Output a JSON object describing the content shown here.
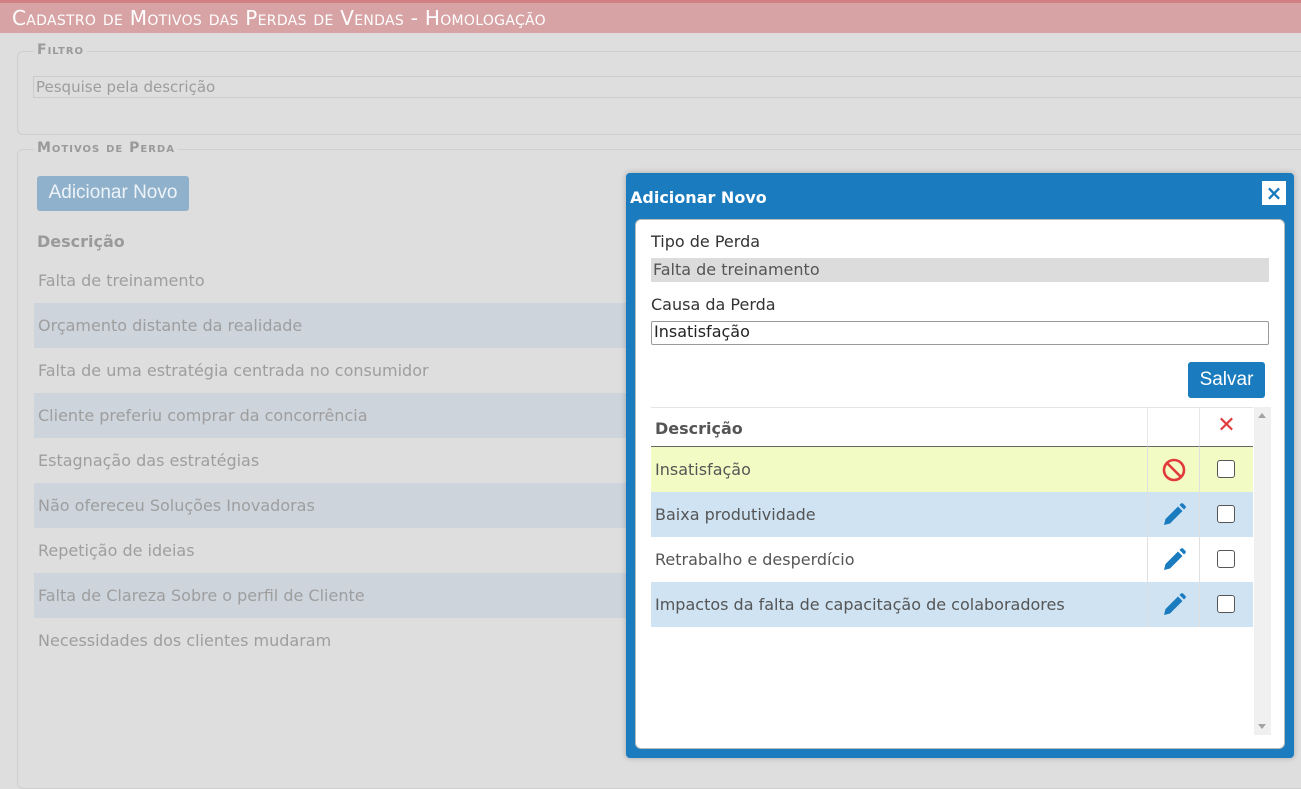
{
  "page": {
    "title": "Cadastro de Motivos das Perdas de Vendas  - Homologação"
  },
  "filter": {
    "legend": "Filtro",
    "placeholder": "Pesquise pela descrição"
  },
  "motivos": {
    "legend": "Motivos de Perda",
    "add_button": "Adicionar Novo",
    "column_header": "Descrição",
    "rows": [
      "Falta de treinamento",
      "Orçamento distante da realidade",
      "Falta de uma estratégia centrada no consumidor",
      "Cliente preferiu comprar da concorrência",
      "Estagnação das estratégias",
      "Não ofereceu Soluções Inovadoras",
      "Repetição de ideias",
      "Falta de Clareza Sobre o perfil de Cliente",
      "Necessidades dos clientes mudaram"
    ]
  },
  "modal": {
    "title": "Adicionar Novo",
    "close_icon": "×",
    "tipo_label": "Tipo de Perda",
    "tipo_value": "Falta de treinamento",
    "causa_label": "Causa da Perda",
    "causa_value": "Insatisfação",
    "save_button": "Salvar",
    "table": {
      "header_desc": "Descrição",
      "header_delete_icon": "✕",
      "rows": [
        {
          "desc": "Insatisfação",
          "action": "blocked-icon",
          "highlight": "#f3fbc4"
        },
        {
          "desc": "Baixa produtividade",
          "action": "pencil-icon",
          "highlight": "#cfe3f3"
        },
        {
          "desc": "Retrabalho e desperdício",
          "action": "pencil-icon",
          "highlight": "#ffffff"
        },
        {
          "desc": "Impactos da falta de capacitação de colaboradores",
          "action": "pencil-icon",
          "highlight": "#cfe3f3"
        }
      ]
    }
  },
  "colors": {
    "title_bar": "#d7a3a5",
    "modal_blue": "#1a7bbf",
    "danger": "#e23a3a"
  }
}
